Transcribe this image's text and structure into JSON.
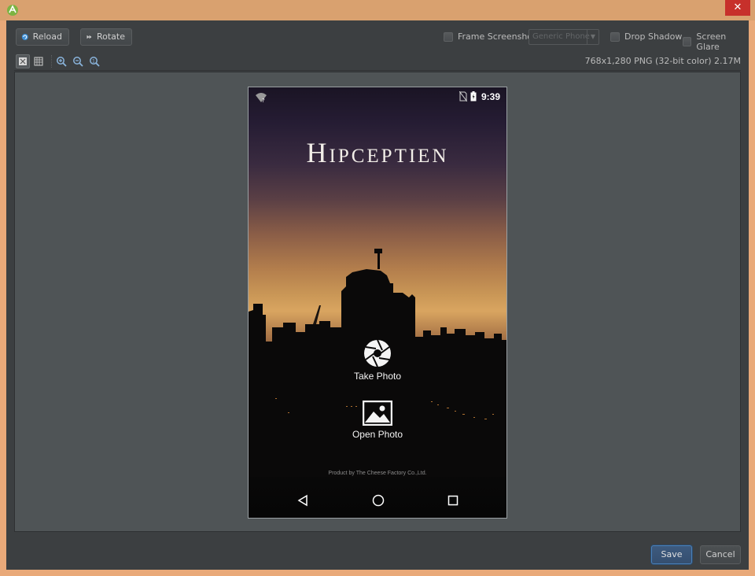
{
  "window": {
    "close_glyph": "✕"
  },
  "toolbar": {
    "reload_label": "Reload",
    "rotate_label": "Rotate",
    "frame_screenshot_label": "Frame Screenshot",
    "frame_screenshot_checked": false,
    "device_select_value": "Generic Phone",
    "drop_shadow_label": "Drop Shadow",
    "drop_shadow_checked": false,
    "screen_glare_label": "Screen Glare",
    "screen_glare_checked": false
  },
  "view_toolbar": {
    "icons": [
      "fit-icon",
      "actual-size-icon",
      "zoom-in-icon",
      "zoom-out-icon",
      "zoom-actual-icon"
    ],
    "image_info": "768x1,280 PNG (32-bit color) 2.17M"
  },
  "phone": {
    "status_time": "9:39",
    "app_logo": "Hipceptien",
    "take_photo_label": "Take Photo",
    "open_photo_label": "Open Photo",
    "credit": "Product by The Cheese Factory Co.,Ltd."
  },
  "footer": {
    "save_label": "Save",
    "cancel_label": "Cancel"
  },
  "colors": {
    "dialog_bg": "#3c3f41",
    "preview_bg": "#4f5456",
    "window_frame": "#e9a979",
    "close_button": "#c7302b",
    "default_button_border": "#4a80b8"
  }
}
